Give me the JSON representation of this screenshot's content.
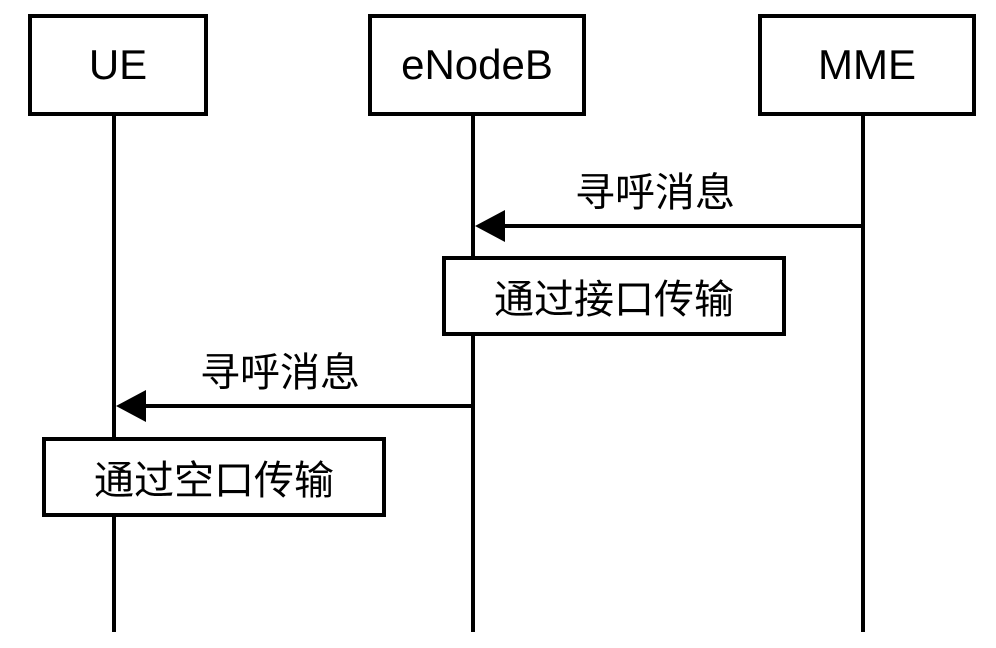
{
  "participants": {
    "ue": {
      "label": "UE"
    },
    "enodeb": {
      "label": "eNodeB"
    },
    "mme": {
      "label": "MME"
    }
  },
  "messages": {
    "msg1": {
      "label": "寻呼消息"
    },
    "msg2": {
      "label": "寻呼消息"
    }
  },
  "activations": {
    "act1": {
      "label": "通过接口传输"
    },
    "act2": {
      "label": "通过空口传输"
    }
  }
}
